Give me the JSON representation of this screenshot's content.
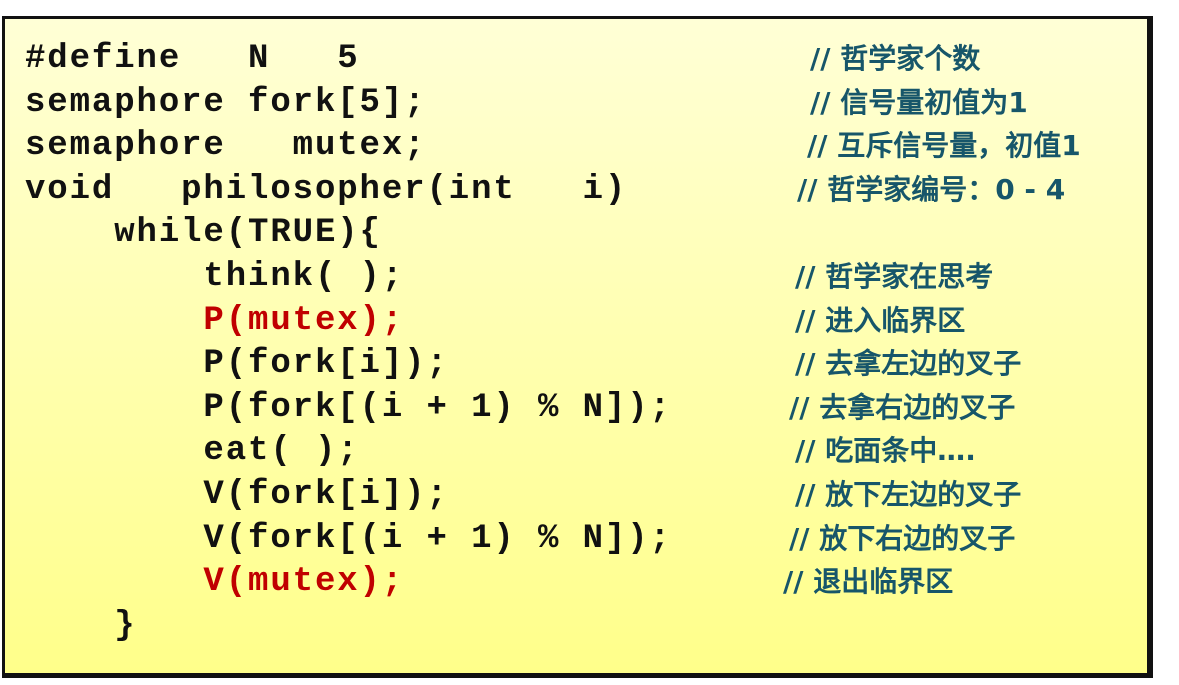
{
  "colors": {
    "code": "#111111",
    "highlight": "#c00000",
    "comment": "#17566a",
    "background_top": "#ffffd6",
    "background_bottom": "#ffff8a"
  },
  "lines": [
    {
      "code": "#define   N   5",
      "comment": "// 哲学家个数"
    },
    {
      "code": "semaphore fork[5];",
      "comment": "// 信号量初值为1"
    },
    {
      "code": "semaphore   mutex;",
      "comment": "// 互斥信号量，初值1"
    },
    {
      "code": "void   philosopher(int   i)",
      "comment": "// 哲学家编号：0 - 4"
    },
    {
      "code": "    while(TRUE){",
      "comment": ""
    },
    {
      "code": "        think( );",
      "comment": "// 哲学家在思考"
    },
    {
      "code": "        P(mutex);",
      "comment": "// 进入临界区",
      "highlight": true
    },
    {
      "code": "        P(fork[i]);",
      "comment": "// 去拿左边的叉子"
    },
    {
      "code": "        P(fork[(i + 1) % N]);",
      "comment": "// 去拿右边的叉子"
    },
    {
      "code": "        eat( );",
      "comment": "// 吃面条中…."
    },
    {
      "code": "        V(fork[i]);",
      "comment": "// 放下左边的叉子"
    },
    {
      "code": "        V(fork[(i + 1) % N]);",
      "comment": "// 放下右边的叉子"
    },
    {
      "code": "        V(mutex);",
      "comment": "// 退出临界区",
      "highlight": true
    },
    {
      "code": "    }",
      "comment": ""
    }
  ]
}
